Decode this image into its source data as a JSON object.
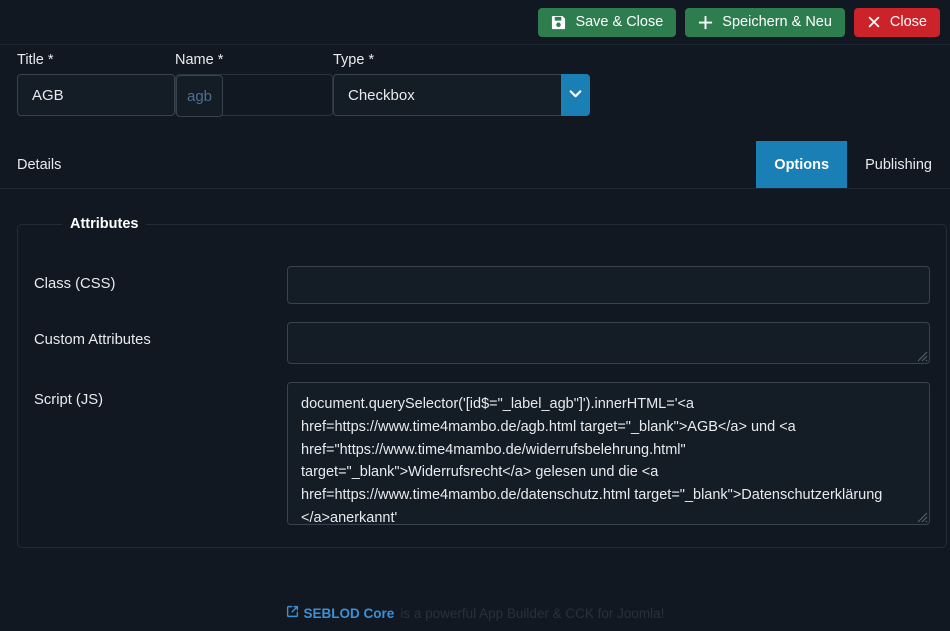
{
  "toolbar": {
    "buttons": [
      {
        "label": "Save & Close",
        "icon": "save-icon",
        "style": "green"
      },
      {
        "label": "Speichern & Neu",
        "icon": "plus-icon",
        "style": "green"
      },
      {
        "label": "Close",
        "icon": "close-icon",
        "style": "red"
      }
    ]
  },
  "fields": {
    "title_label": "Title *",
    "name_label": "Name *",
    "type_label": "Type *",
    "title_value": "AGB",
    "name_value": "",
    "name_placeholder": "agb",
    "type_value": "Checkbox",
    "type_options": [
      "Checkbox"
    ]
  },
  "tabs": {
    "details_label": "Details",
    "items": [
      {
        "label": "Options",
        "active": true
      },
      {
        "label": "Publishing",
        "active": false
      }
    ]
  },
  "attributes": {
    "legend": "Attributes",
    "class_css_label": "Class (CSS)",
    "class_css_value": "",
    "custom_attributes_label": "Custom Attributes",
    "custom_attributes_value": "",
    "script_js_label": "Script (JS)",
    "script_js_value": "document.querySelector('[id$=\"_label_agb\"]').innerHTML='<a href=https://www.time4mambo.de/agb.html target=\"_blank\">AGB</a> und <a href=\"https://www.time4mambo.de/widerrufsbelehrung.html\" target=\"_blank\">Widerrufsrecht</a> gelesen und die <a href=https://www.time4mambo.de/datenschutz.html target=\"_blank\">Datenschutzerklärung </a>anerkannt'"
  },
  "footer": {
    "link_label": "SEBLOD Core",
    "tagline": "is a powerful App Builder & CCK for Joomla!",
    "link_icon": "external-link-icon"
  },
  "colors": {
    "background": "#111821",
    "accent_blue": "#1a7fb5",
    "green": "#2e7d4f",
    "red": "#cc2229",
    "link_blue": "#3d8fd6",
    "placeholder_blue": "#4d6f93"
  }
}
